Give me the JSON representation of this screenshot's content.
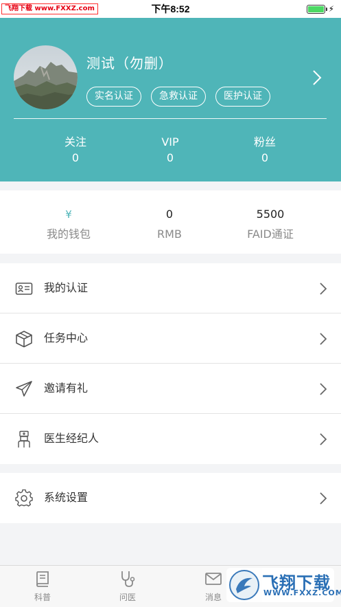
{
  "status_bar": {
    "time": "下午8:52",
    "watermark": "飞翔下载 www.FXXZ.com"
  },
  "profile": {
    "name": "测试（勿删）",
    "badges": [
      "实名认证",
      "急救认证",
      "医护认证"
    ],
    "stats": [
      {
        "label": "关注",
        "value": "0"
      },
      {
        "label": "VIP",
        "value": "0"
      },
      {
        "label": "粉丝",
        "value": "0"
      }
    ]
  },
  "wallet": {
    "columns": [
      {
        "value": "¥",
        "label": "我的钱包"
      },
      {
        "value": "0",
        "label": "RMB"
      },
      {
        "value": "5500",
        "label": "FAID通证"
      }
    ]
  },
  "menu": {
    "items": [
      {
        "label": "我的认证",
        "icon": "id-card-icon"
      },
      {
        "label": "任务中心",
        "icon": "box-icon"
      },
      {
        "label": "邀请有礼",
        "icon": "paper-plane-icon"
      },
      {
        "label": "医生经纪人",
        "icon": "doctor-icon"
      }
    ],
    "settings": {
      "label": "系统设置",
      "icon": "gear-icon"
    }
  },
  "tabbar": {
    "tabs": [
      {
        "label": "科普",
        "icon": "book-icon"
      },
      {
        "label": "问医",
        "icon": "stethoscope-icon"
      },
      {
        "label": "消息",
        "icon": "mail-icon"
      }
    ],
    "watermark_text": "飞翔下载",
    "watermark_url": "WWW.FXXZ.COM"
  },
  "colors": {
    "accent": "#4fb5b8",
    "battery": "#4cd964"
  }
}
